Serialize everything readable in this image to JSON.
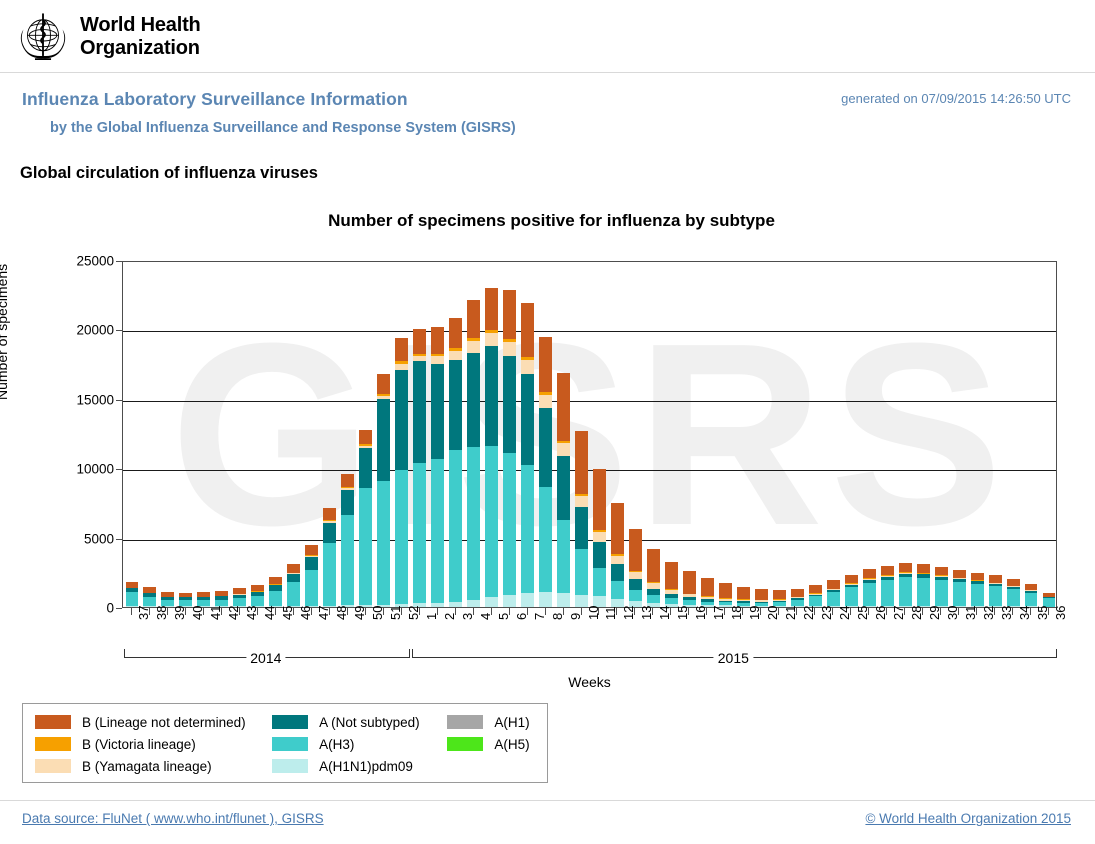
{
  "header": {
    "logo_alt": "World Health Organization",
    "wordmark_line1": "World Health",
    "wordmark_line2": "Organization"
  },
  "titles": {
    "main": "Influenza Laboratory Surveillance Information",
    "sub": "by the Global Influenza Surveillance and Response System (GISRS)",
    "generated": "generated on 07/09/2015 14:26:50 UTC",
    "section": "Global circulation of influenza viruses"
  },
  "footer": {
    "data_source": "Data source: FluNet ( www.who.int/flunet ), GISRS",
    "copyright": "© World Health Organization 2015"
  },
  "colors": {
    "b_not_determined": "#C85A1E",
    "b_victoria": "#F6A000",
    "b_yamagata": "#FBDDB4",
    "a_not_subtyped": "#00777D",
    "a_h3": "#3FCCCB",
    "a_h1n1pdm09": "#BDEDEC",
    "a_h1": "#A6A6A6",
    "a_h5": "#4DE61A",
    "title_blue": "#5b86b3",
    "link_blue": "#4a7ab0",
    "watermark": "#f0f0f0"
  },
  "chart_data": {
    "type": "bar",
    "stacked": true,
    "title": "Number of specimens positive for influenza by subtype",
    "xlabel": "Weeks",
    "ylabel": "Number of specimens",
    "ylim": [
      0,
      25000
    ],
    "yticks": [
      0,
      5000,
      10000,
      15000,
      20000,
      25000
    ],
    "grid": true,
    "legend_position": "below-left",
    "watermark_text": "GISRS",
    "year_groups": [
      {
        "label": "2014",
        "start_index": 0,
        "end_index": 15
      },
      {
        "label": "2015",
        "start_index": 16,
        "end_index": 51
      }
    ],
    "categories": [
      "37",
      "38",
      "39",
      "40",
      "41",
      "42",
      "43",
      "44",
      "45",
      "46",
      "47",
      "48",
      "49",
      "50",
      "51",
      "52",
      "1",
      "2",
      "3",
      "4",
      "5",
      "6",
      "7",
      "8",
      "9",
      "10",
      "11",
      "12",
      "13",
      "14",
      "15",
      "16",
      "17",
      "18",
      "19",
      "20",
      "21",
      "22",
      "23",
      "24",
      "25",
      "26",
      "27",
      "28",
      "29",
      "30",
      "31",
      "32",
      "33",
      "34",
      "35",
      "36"
    ],
    "series": [
      {
        "name": "A(H1N1)pdm09",
        "color": "#BDEDEC",
        "values": [
          60,
          50,
          40,
          40,
          40,
          40,
          50,
          60,
          60,
          70,
          80,
          100,
          120,
          140,
          160,
          200,
          260,
          300,
          380,
          520,
          700,
          900,
          1000,
          1050,
          1000,
          900,
          800,
          600,
          450,
          320,
          230,
          170,
          130,
          110,
          90,
          80,
          70,
          60,
          60,
          60,
          60,
          60,
          60,
          60,
          60,
          60,
          50,
          50,
          50,
          40,
          40,
          30
        ]
      },
      {
        "name": "A(H3)",
        "color": "#3FCCCB",
        "values": [
          1000,
          700,
          450,
          450,
          450,
          500,
          600,
          700,
          1100,
          1700,
          2600,
          4500,
          6500,
          8400,
          8900,
          9700,
          10100,
          10400,
          10900,
          11000,
          10900,
          10200,
          9200,
          7600,
          5300,
          3300,
          2000,
          1300,
          800,
          560,
          420,
          320,
          260,
          220,
          200,
          210,
          280,
          450,
          700,
          1000,
          1350,
          1700,
          1900,
          2100,
          2050,
          1900,
          1750,
          1600,
          1450,
          1250,
          1000,
          600
        ]
      },
      {
        "name": "A (Not subtyped)",
        "color": "#00777D",
        "values": [
          280,
          250,
          200,
          200,
          200,
          220,
          250,
          300,
          400,
          600,
          900,
          1450,
          1800,
          2900,
          5900,
          7200,
          7400,
          6800,
          6500,
          6800,
          7200,
          7000,
          6600,
          5700,
          4600,
          3000,
          1900,
          1200,
          750,
          450,
          300,
          210,
          160,
          130,
          110,
          100,
          100,
          110,
          130,
          160,
          190,
          210,
          230,
          240,
          240,
          230,
          220,
          200,
          190,
          170,
          140,
          90
        ]
      },
      {
        "name": "B (Yamagata lineage)",
        "color": "#FBDDB4",
        "values": [
          30,
          25,
          20,
          20,
          20,
          25,
          30,
          40,
          50,
          60,
          80,
          120,
          150,
          180,
          250,
          420,
          330,
          560,
          700,
          850,
          950,
          1000,
          1000,
          950,
          900,
          800,
          700,
          600,
          500,
          400,
          300,
          220,
          170,
          130,
          110,
          90,
          80,
          70,
          70,
          70,
          70,
          70,
          70,
          70,
          65,
          60,
          55,
          50,
          45,
          40,
          35,
          25
        ]
      },
      {
        "name": "B (Victoria lineage)",
        "color": "#F6A000",
        "values": [
          25,
          20,
          18,
          18,
          18,
          20,
          22,
          28,
          35,
          45,
          60,
          80,
          100,
          120,
          150,
          180,
          160,
          170,
          180,
          190,
          190,
          190,
          190,
          180,
          170,
          150,
          130,
          110,
          95,
          80,
          65,
          55,
          45,
          40,
          35,
          30,
          30,
          30,
          30,
          30,
          30,
          30,
          30,
          30,
          28,
          26,
          25,
          22,
          20,
          18,
          16,
          12
        ]
      },
      {
        "name": "B (Lineage not determined)",
        "color": "#C85A1E",
        "values": [
          400,
          380,
          330,
          320,
          330,
          360,
          400,
          460,
          540,
          620,
          730,
          870,
          950,
          1000,
          1450,
          1700,
          1800,
          1950,
          2200,
          2750,
          3050,
          3550,
          3900,
          4000,
          4900,
          4500,
          4450,
          3700,
          3050,
          2400,
          1950,
          1620,
          1350,
          1100,
          900,
          760,
          650,
          600,
          580,
          600,
          620,
          640,
          660,
          670,
          650,
          620,
          590,
          560,
          520,
          470,
          400,
          260
        ]
      }
    ],
    "legend_entries": [
      {
        "label": "B (Lineage not determined)",
        "color": "#C85A1E"
      },
      {
        "label": "B (Victoria lineage)",
        "color": "#F6A000"
      },
      {
        "label": "B (Yamagata lineage)",
        "color": "#FBDDB4"
      },
      {
        "label": "A (Not subtyped)",
        "color": "#00777D"
      },
      {
        "label": "A(H3)",
        "color": "#3FCCCB"
      },
      {
        "label": "A(H1N1)pdm09",
        "color": "#BDEDEC"
      },
      {
        "label": "A(H1)",
        "color": "#A6A6A6"
      },
      {
        "label": "A(H5)",
        "color": "#4DE61A"
      }
    ]
  }
}
